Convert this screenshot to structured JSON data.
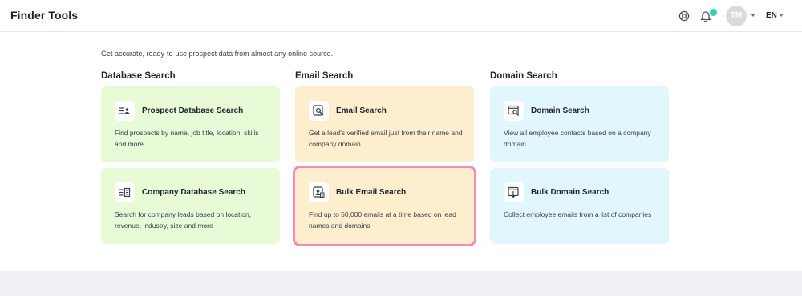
{
  "header": {
    "title": "Finder Tools",
    "icons": [
      "help-icon",
      "bell-icon"
    ],
    "avatar_initials": "TM",
    "language": "EN",
    "notification_dot_color": "#2fd3b4"
  },
  "intro": "Get accurate, ready-to-use prospect data from almost any online source.",
  "columns": [
    {
      "title": "Database Search",
      "color": "#e8fad6",
      "cards": [
        {
          "title": "Prospect Database Search",
          "desc": "Find prospects by name, job title, location, skills and more",
          "icon": "prospect-list-icon"
        },
        {
          "title": "Company Database Search",
          "desc": "Search for company leads based on location, revenue, industry, size and more",
          "icon": "company-list-icon"
        }
      ]
    },
    {
      "title": "Email Search",
      "color": "#fdeecd",
      "cards": [
        {
          "title": "Email Search",
          "desc": "Get a lead's verified email just from their name and company domain",
          "icon": "email-search-icon"
        },
        {
          "title": "Bulk Email Search",
          "desc": "Find up to 50,000 emails at a time based on lead names and domains",
          "icon": "bulk-email-icon",
          "highlight_color": "#f58bb0"
        }
      ]
    },
    {
      "title": "Domain Search",
      "color": "#e2f7fd",
      "cards": [
        {
          "title": "Domain Search",
          "desc": "View all employee contacts based on a company domain",
          "icon": "domain-search-icon"
        },
        {
          "title": "Bulk Domain Search",
          "desc": "Collect employee emails from a list of companies",
          "icon": "bulk-domain-icon"
        }
      ]
    }
  ]
}
